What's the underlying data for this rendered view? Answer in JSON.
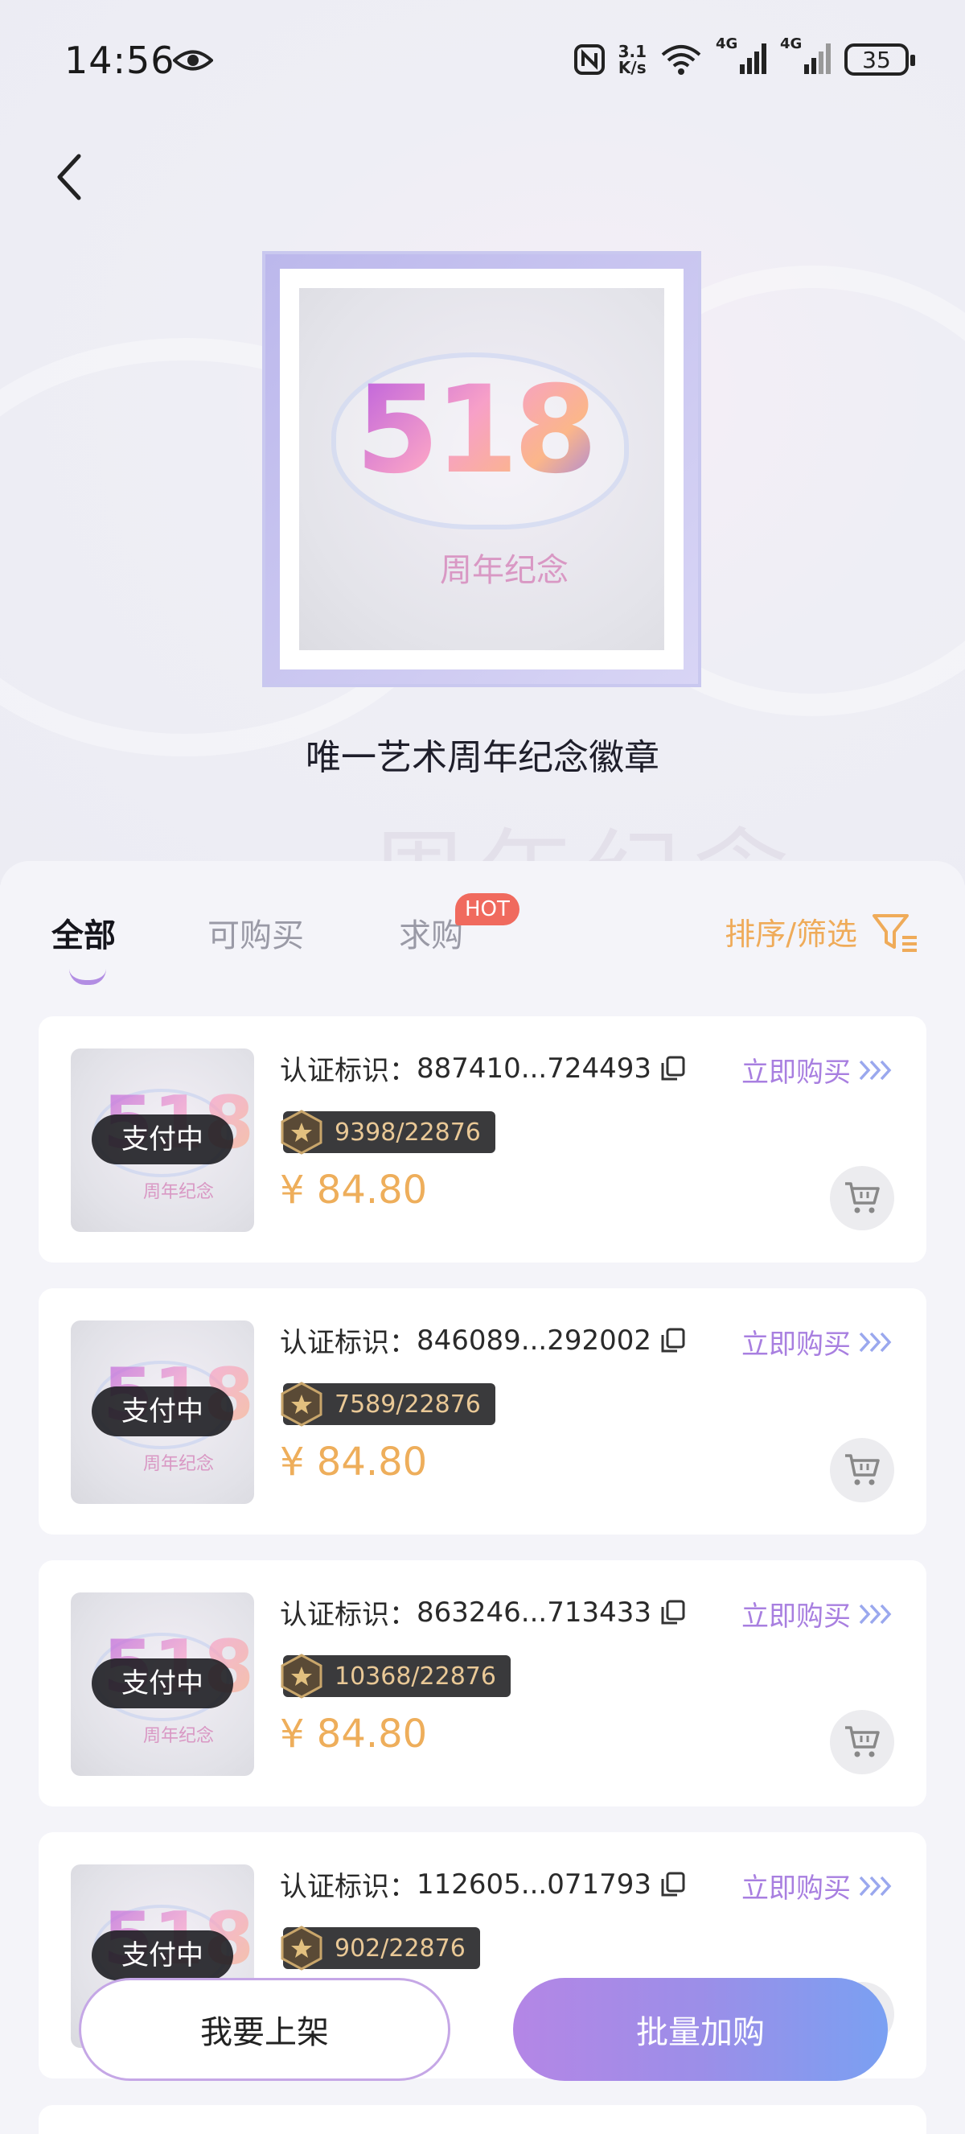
{
  "status_bar": {
    "time": "14:56",
    "net_speed_value": "3.1",
    "net_speed_unit": "K/s",
    "signal_1": "4G",
    "signal_2": "4G",
    "battery": "35"
  },
  "artwork": {
    "title": "唯一艺术周年纪念徽章",
    "image_number": "518",
    "image_caption": "周年纪念"
  },
  "tabs": {
    "all": "全部",
    "buyable": "可购买",
    "wanted": "求购",
    "hot_badge": "HOT",
    "sort_filter": "排序/筛选"
  },
  "listings": [
    {
      "status": "支付中",
      "cert_label": "认证标识：",
      "cert_id": "887410...724493",
      "buy_now": "立即购买",
      "serial": "9398/22876",
      "price": "¥ 84.80"
    },
    {
      "status": "支付中",
      "cert_label": "认证标识：",
      "cert_id": "846089...292002",
      "buy_now": "立即购买",
      "serial": "7589/22876",
      "price": "¥ 84.80"
    },
    {
      "status": "支付中",
      "cert_label": "认证标识：",
      "cert_id": "863246...713433",
      "buy_now": "立即购买",
      "serial": "10368/22876",
      "price": "¥ 84.80"
    },
    {
      "status": "支付中",
      "cert_label": "认证标识：",
      "cert_id": "112605...071793",
      "buy_now": "立即购买",
      "serial": "902/22876",
      "price": ""
    }
  ],
  "bottom_bar": {
    "list_item_button": "我要上架",
    "batch_buy_button": "批量加购"
  },
  "colors": {
    "accent_purple": "#a87fe0",
    "price_orange": "#eeae5b",
    "hot_red": "#f06a5e",
    "serial_gold": "#e9c896"
  }
}
